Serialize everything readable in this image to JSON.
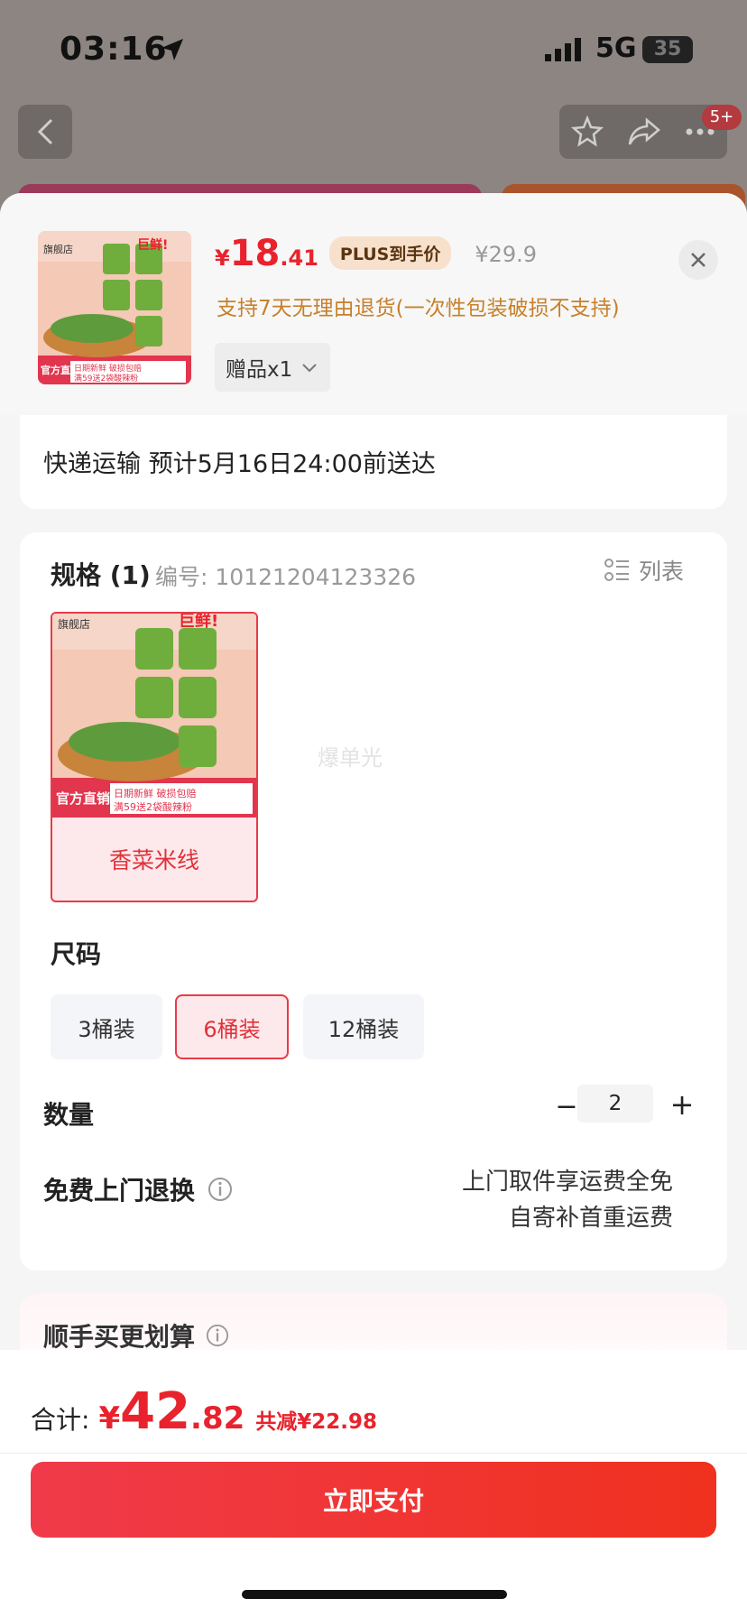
{
  "status_bar": {
    "time": "03:16",
    "network": "5G",
    "battery": "35"
  },
  "topbar": {
    "badge": "5+"
  },
  "product": {
    "price": {
      "currency": "¥",
      "integer": "18",
      "decimal": ".41"
    },
    "plus_tag": "PLUS到手价",
    "original_price": "¥29.9",
    "return_policy": "支持7天无理由退货(一次性包装破损不支持)",
    "gift_label": "赠品x1",
    "thumb_texts": {
      "shop": "旗舰店",
      "slogan": "巨鲜!",
      "official": "官方直销",
      "promo": "日期新鲜 破损包赔",
      "promo2": "满59送2袋酸辣粉"
    }
  },
  "shipping": {
    "text": "快递运输 预计5月16日24:00前送达"
  },
  "spec": {
    "title": "规格 (1)",
    "code": "编号: 10121204123326",
    "list_label": "列表",
    "option_label": "香菜米线",
    "watermark": "爆单光"
  },
  "size": {
    "title": "尺码",
    "options": [
      "3桶装",
      "6桶装",
      "12桶装"
    ],
    "selected": "6桶装"
  },
  "quantity": {
    "title": "数量",
    "minus": "−",
    "value": "2",
    "plus": "+"
  },
  "free_return": {
    "title": "免费上门退换",
    "line1": "上门取件享运费全免",
    "line2": "自寄补首重运费"
  },
  "bundle": {
    "title": "顺手买更划算"
  },
  "footer": {
    "total_label": "合计:",
    "total": {
      "currency": "¥",
      "integer": "42",
      "decimal": ".82"
    },
    "saving": "共减¥22.98",
    "pay_label": "立即支付"
  },
  "colors": {
    "accent": "#e8232d",
    "plus_bg": "#f7e0cc",
    "return_text": "#c7802b",
    "selected_bg": "#fde9ec"
  }
}
